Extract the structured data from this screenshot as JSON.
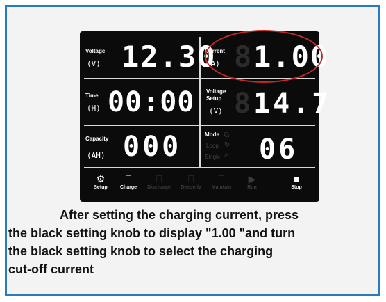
{
  "lcd": {
    "voltage": {
      "label": "Voltage",
      "unit": "(V)",
      "value": "12.30"
    },
    "current": {
      "label": "Current",
      "unit": "(A)",
      "value": "1.00"
    },
    "time": {
      "label": "Time",
      "unit": "(H)",
      "value": "00:00"
    },
    "voltage_setup": {
      "label_line1": "Voltage",
      "label_line2": "Setup",
      "unit": "(V)",
      "value": "14.7"
    },
    "capacity": {
      "label": "Capacity",
      "unit": "(AH)",
      "value": "000"
    },
    "mode": {
      "label": "Mode",
      "option1": "Loop",
      "option2": "Single",
      "value": "06"
    },
    "buttons": [
      {
        "label": "Setup",
        "icon": "gear-icon",
        "glyph": "⚙",
        "active": true
      },
      {
        "label": "Charge",
        "icon": "battery-charge-icon",
        "glyph": "⎕",
        "active": true
      },
      {
        "label": "Discharge",
        "icon": "battery-discharge-icon",
        "glyph": "⎕",
        "active": false
      },
      {
        "label": "Deeoerly",
        "icon": "battery-maintain-icon",
        "glyph": "⎕",
        "active": false
      },
      {
        "label": "Maintain",
        "icon": "battery-detect-icon",
        "glyph": "⎕",
        "active": false
      },
      {
        "label": "Run",
        "icon": "play-icon",
        "glyph": "▶",
        "active": false
      },
      {
        "label": "Stop",
        "icon": "stop-icon",
        "glyph": "■",
        "active": true
      }
    ]
  },
  "highlight_color": "#c62828",
  "border_color": "#2a7bbd",
  "caption": {
    "line1": "After setting the charging current, press",
    "line2": "the black setting knob to display \"1.00 \"and turn",
    "line3": "the black setting knob to select the charging",
    "line4": "cut-off current"
  }
}
